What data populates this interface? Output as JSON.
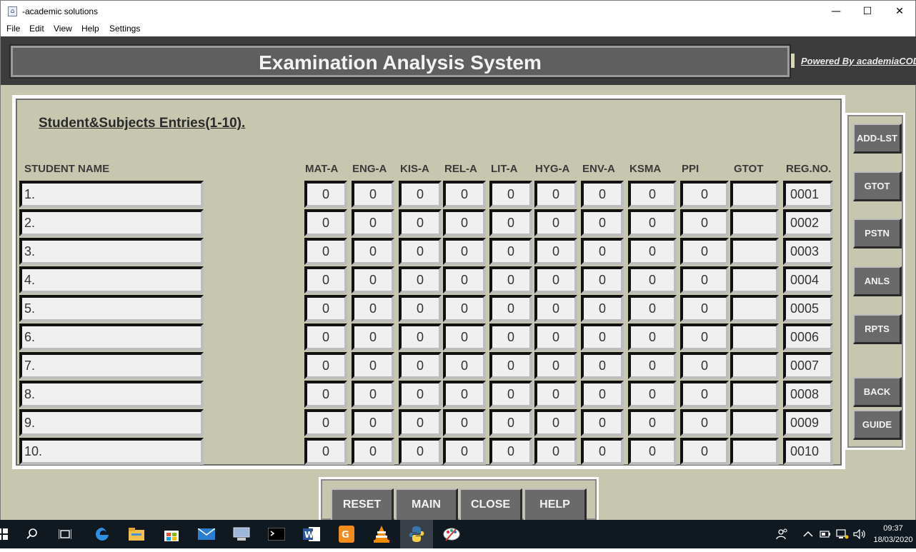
{
  "window": {
    "title": "-academic solutions",
    "icon": "app-icon"
  },
  "menu": [
    "File",
    "Edit",
    "View",
    "Help",
    "Settings"
  ],
  "header": {
    "title": "Examination Analysis System",
    "powered_by": "Powered By academiaCOD"
  },
  "section_title": "Student&Subjects Entries(1-10).",
  "columns": {
    "student": "STUDENT NAME",
    "subjects": [
      "MAT-A",
      "ENG-A",
      "KIS-A",
      "REL-A",
      "LIT-A",
      "HYG-A",
      "ENV-A",
      "KSMA",
      "PPI"
    ],
    "gtot": "GTOT",
    "reg": "REG.NO."
  },
  "rows": [
    {
      "name": "1.",
      "scores": [
        "0",
        "0",
        "0",
        "0",
        "0",
        "0",
        "0",
        "0",
        "0"
      ],
      "gtot": "",
      "reg": "0001"
    },
    {
      "name": "2.",
      "scores": [
        "0",
        "0",
        "0",
        "0",
        "0",
        "0",
        "0",
        "0",
        "0"
      ],
      "gtot": "",
      "reg": "0002"
    },
    {
      "name": "3.",
      "scores": [
        "0",
        "0",
        "0",
        "0",
        "0",
        "0",
        "0",
        "0",
        "0"
      ],
      "gtot": "",
      "reg": "0003"
    },
    {
      "name": "4.",
      "scores": [
        "0",
        "0",
        "0",
        "0",
        "0",
        "0",
        "0",
        "0",
        "0"
      ],
      "gtot": "",
      "reg": "0004"
    },
    {
      "name": "5.",
      "scores": [
        "0",
        "0",
        "0",
        "0",
        "0",
        "0",
        "0",
        "0",
        "0"
      ],
      "gtot": "",
      "reg": "0005"
    },
    {
      "name": "6.",
      "scores": [
        "0",
        "0",
        "0",
        "0",
        "0",
        "0",
        "0",
        "0",
        "0"
      ],
      "gtot": "",
      "reg": "0006"
    },
    {
      "name": "7.",
      "scores": [
        "0",
        "0",
        "0",
        "0",
        "0",
        "0",
        "0",
        "0",
        "0"
      ],
      "gtot": "",
      "reg": "0007"
    },
    {
      "name": "8.",
      "scores": [
        "0",
        "0",
        "0",
        "0",
        "0",
        "0",
        "0",
        "0",
        "0"
      ],
      "gtot": "",
      "reg": "0008"
    },
    {
      "name": "9.",
      "scores": [
        "0",
        "0",
        "0",
        "0",
        "0",
        "0",
        "0",
        "0",
        "0"
      ],
      "gtot": "",
      "reg": "0009"
    },
    {
      "name": "10.",
      "scores": [
        "0",
        "0",
        "0",
        "0",
        "0",
        "0",
        "0",
        "0",
        "0"
      ],
      "gtot": "",
      "reg": "0010"
    }
  ],
  "side_buttons": [
    "ADD-LST",
    "GTOT",
    "PSTN",
    "ANLS",
    "RPTS",
    "BACK",
    "GUIDE"
  ],
  "bottom_buttons": [
    "RESET",
    "MAIN",
    "CLOSE",
    "HELP"
  ],
  "taskbar": {
    "icons": [
      "windows-start-icon",
      "search-icon",
      "task-view-icon",
      "edge-icon",
      "file-explorer-icon",
      "store-icon",
      "mail-icon",
      "network-app-icon",
      "terminal-icon",
      "word-icon",
      "pdf-icon",
      "vlc-icon",
      "python-icon",
      "paint-icon"
    ],
    "time": "09:37",
    "date": "18/03/2020"
  }
}
